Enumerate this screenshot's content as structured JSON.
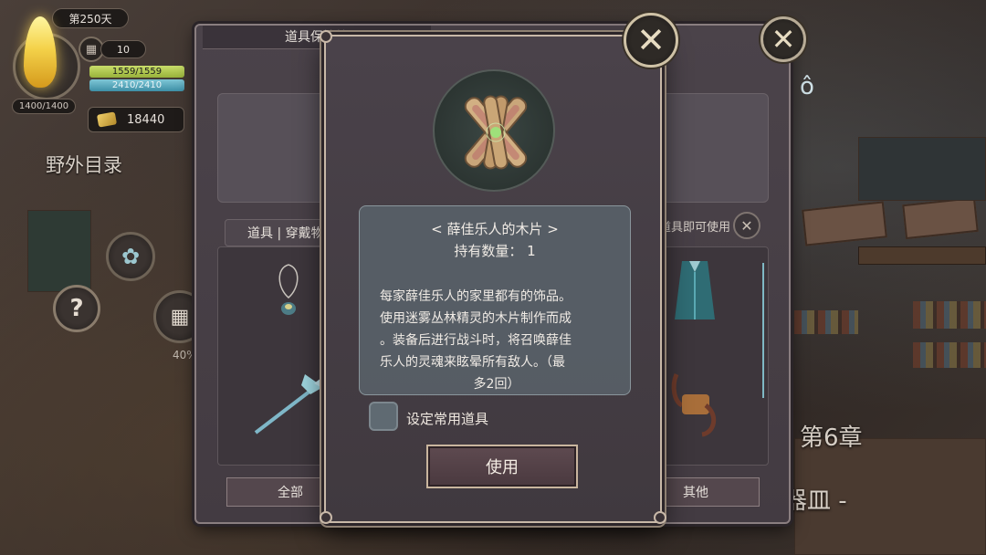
{
  "hud": {
    "day": "第250天",
    "flame_count": "1400/1400",
    "calendar_count": "10",
    "hp": "1559/1559",
    "mp": "2410/2410",
    "gold": "18440",
    "field_catalog": "野外目录",
    "progress_pct": "40%",
    "chapter": "第6章",
    "chapter_sub": "扣器皿 -"
  },
  "storage_panel": {
    "title": "道具保管箱",
    "tab_label": "道具 | 穿戴物",
    "hint": "道具即可使用",
    "btn_all": "全部",
    "btn_other": "其他"
  },
  "dialog": {
    "item_name": "< 薛佳乐人的木片 >",
    "quantity": "持有数量： 1",
    "description_lines": [
      "每家薛佳乐人的家里都有的饰品。",
      "使用迷雾丛林精灵的木片制作而成",
      "。装备后进行战斗时，将召唤薛佳",
      "乐人的灵魂来眩晕所有敌人。（最",
      "多2回）"
    ],
    "checkbox_label": "设定常用道具",
    "use_button": "使用"
  },
  "icons": {
    "close": "close-icon",
    "item": "wood-chip-icon",
    "gear": "gear-icon",
    "help": "help-icon",
    "calendar": "calendar-icon",
    "gold": "gold-icon",
    "flame": "flame-icon"
  },
  "colors": {
    "hp_bar": "#b5c94f",
    "mp_bar": "#5aa8bd",
    "dialog_border": "#c8b8a8"
  }
}
